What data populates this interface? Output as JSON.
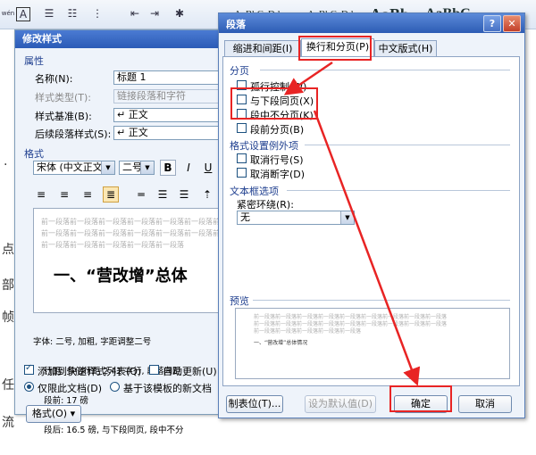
{
  "ribbon": {
    "styles": [
      "AaBbCcDd",
      "AaBbCcDd",
      "AaBb",
      "AaBbC"
    ],
    "left_glyphs": [
      "wén",
      "A"
    ]
  },
  "document": {
    "fragments": [
      "点",
      "部",
      "帧",
      "任",
      "流",
      "·"
    ]
  },
  "modify_dialog": {
    "title": "修改样式",
    "properties_group": "属性",
    "name_label": "名称(N):",
    "name_value": "标题 1",
    "style_type_label": "样式类型(T):",
    "style_type_value": "链接段落和字符",
    "based_on_label": "样式基准(B):",
    "based_on_value": "↵ 正文",
    "following_label": "后续段落样式(S):",
    "following_value": "↵ 正文",
    "format_group": "格式",
    "font_value": "宋体 (中文正文)",
    "size_value": "二号",
    "bold": "B",
    "italic": "I",
    "underline": "U",
    "preview_lines": [
      "前一段落前一段落前一段落前一段落前一段落前一段落前一段落前一段落前一段落",
      "前一段落前一段落前一段落前一段落前一段落前一段落前一段落前一段落前一段落",
      "前一段落前一段落前一段落前一段落前一段落"
    ],
    "preview_heading": "一、“营改增”总体",
    "desc_lines": [
      "字体: 二号, 加粗, 字距调整二号",
      "    行距: 多倍行距 2.41 字行, 段落间距",
      "    段前: 17 磅",
      "    段后: 16.5 磅, 与下段同页, 段中不分"
    ],
    "add_quick_label": "添加到快速样式列表(Q)",
    "auto_update_label": "自动更新(U)",
    "only_doc_label": "仅限此文档(D)",
    "template_label": "基于该模板的新文档",
    "format_button": "格式(O) ▾"
  },
  "para_dialog": {
    "title": "段落",
    "help": "?",
    "close": "✕",
    "tabs": [
      "缩进和间距(I)",
      "换行和分页(P)",
      "中文版式(H)"
    ],
    "pagination_group": "分页",
    "widow_label": "孤行控制(W)",
    "keep_next_label": "与下段同页(X)",
    "keep_lines_label": "段中不分页(K)",
    "page_break_label": "段前分页(B)",
    "exceptions_group": "格式设置例外项",
    "suppress_ln_label": "取消行号(S)",
    "no_hyphen_label": "取消断字(D)",
    "textbox_group": "文本框选项",
    "tight_wrap_label": "紧密环绕(R):",
    "tight_wrap_value": "无",
    "preview_group": "预览",
    "preview_caption": "一、“营改增”总体情况",
    "tabs_button": "制表位(T)...",
    "default_button": "设为默认值(D)",
    "ok_button": "确定",
    "cancel_button": "取消"
  },
  "colors": {
    "highlight": "#e82424",
    "title_bar": "#2d5cb4",
    "group_text": "#1f3f8f"
  }
}
